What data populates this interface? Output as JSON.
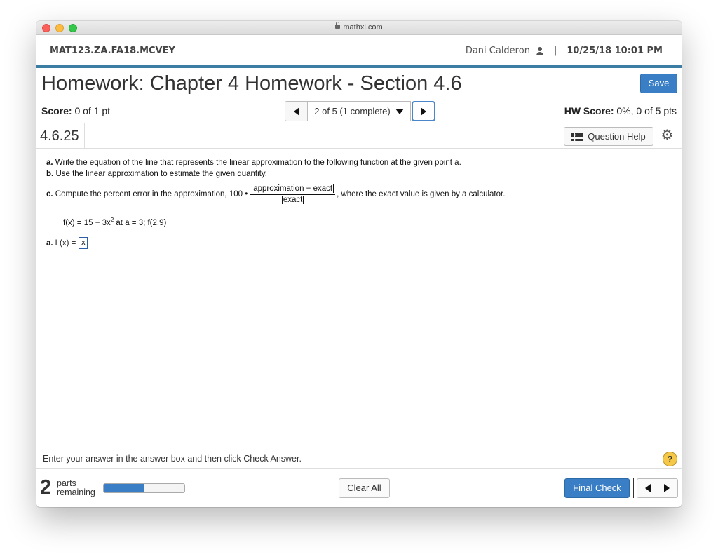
{
  "browser": {
    "url": "mathxl.com"
  },
  "header": {
    "course_id": "MAT123.ZA.FA18.MCVEY",
    "user_name": "Dani Calderon",
    "separator": "|",
    "datetime": "10/25/18 10:01 PM"
  },
  "homework": {
    "title": "Homework: Chapter 4 Homework - Section 4.6",
    "save_label": "Save"
  },
  "score_bar": {
    "score_label": "Score:",
    "score_value": "0 of 1 pt",
    "question_select": "2 of 5 (1 complete)",
    "hw_score_label": "HW Score:",
    "hw_score_value": "0%, 0 of 5 pts"
  },
  "question": {
    "id": "4.6.25",
    "help_label": "Question Help",
    "part_a_letter": "a.",
    "part_a_text": "Write the equation of the line that represents the linear approximation to the following function at the given point a.",
    "part_b_letter": "b.",
    "part_b_text": "Use the linear approximation to estimate the given quantity.",
    "part_c_letter": "c.",
    "part_c_text": "Compute the percent error in the approximation, 100 •",
    "frac_numerator": "approximation − exact",
    "frac_denominator": "exact",
    "part_c_tail": ", where the exact value is given by a calculator.",
    "func_prefix": "f(x) = 15 − 3x",
    "func_exponent": "2",
    "func_suffix": " at a = 3; f(2.9)"
  },
  "answer": {
    "letter": "a.",
    "label": "L(x) =",
    "value": "x"
  },
  "footer": {
    "instructions": "Enter your answer in the answer box and then click Check Answer.",
    "help_glyph": "?",
    "parts_count": "2",
    "parts_word": "parts",
    "remaining_word": "remaining",
    "progress_fraction": 0.5,
    "clear_label": "Clear All",
    "final_check_label": "Final Check"
  },
  "colors": {
    "accent": "#3a7fc6",
    "header_rule": "#3c7ea3",
    "help_icon": "#f6c848"
  }
}
